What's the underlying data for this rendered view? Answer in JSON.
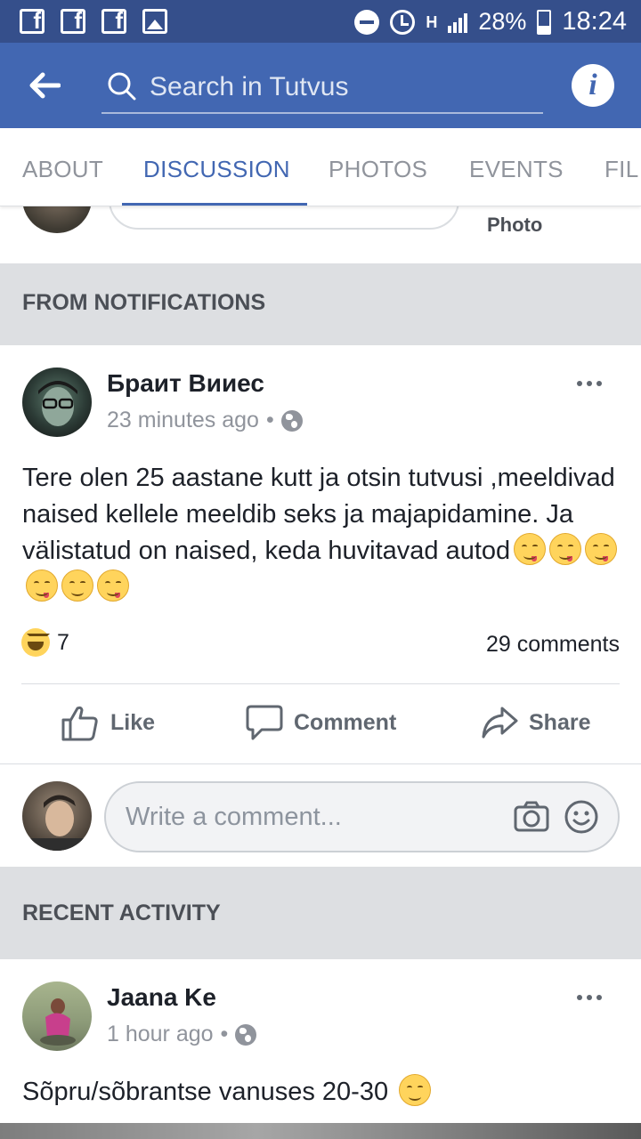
{
  "status_bar": {
    "battery": "28%",
    "time": "18:24",
    "network": "H"
  },
  "search": {
    "placeholder": "Search in Tutvus"
  },
  "tabs": [
    "ABOUT",
    "DISCUSSION",
    "PHOTOS",
    "EVENTS",
    "FIL"
  ],
  "composer": {
    "photo_label": "Photo"
  },
  "sections": {
    "notifications": "FROM NOTIFICATIONS",
    "recent": "RECENT ACTIVITY"
  },
  "post1": {
    "author": "Браит Вииес",
    "time": "23 minutes ago",
    "text": "Tere olen 25 aastane kutt ja otsin tutvusi ,meeldivad naised kellele meeldib seks ja majapidamine. Ja välistatud on naised, keda huvitavad autod",
    "reaction_count": "7",
    "comments": "29 comments",
    "actions": {
      "like": "Like",
      "comment": "Comment",
      "share": "Share"
    },
    "comment_placeholder": "Write a comment..."
  },
  "post2": {
    "author": "Jaana Ke",
    "time": "1 hour ago",
    "text": "Sõpru/sõbrantse vanuses 20-30"
  },
  "colors": {
    "brand": "#4267b2",
    "status_bar": "#354f8b",
    "section_bg": "#dddfe2"
  }
}
